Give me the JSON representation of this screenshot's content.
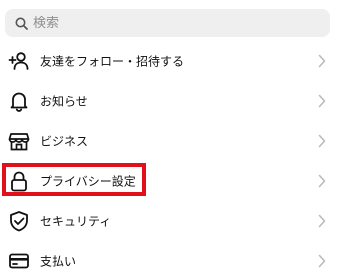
{
  "search": {
    "placeholder": "検索",
    "icon": "search-icon"
  },
  "menu": {
    "items": [
      {
        "label": "友達をフォロー・招待する",
        "icon": "add-person-icon"
      },
      {
        "label": "お知らせ",
        "icon": "bell-icon"
      },
      {
        "label": "ビジネス",
        "icon": "shop-icon"
      },
      {
        "label": "プライバシー設定",
        "icon": "lock-icon",
        "highlighted": true
      },
      {
        "label": "セキュリティ",
        "icon": "shield-check-icon"
      },
      {
        "label": "支払い",
        "icon": "credit-card-icon"
      }
    ]
  },
  "colors": {
    "highlight_border": "#e0111b",
    "search_background": "#efefef",
    "placeholder_text": "#8e8e8e",
    "chevron": "#b8b8b8"
  }
}
